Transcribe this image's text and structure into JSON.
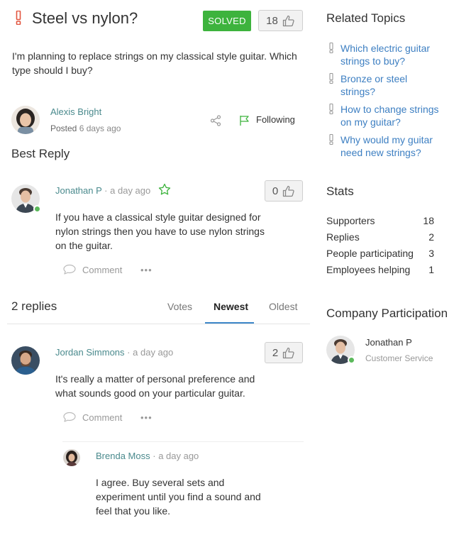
{
  "question": {
    "title": "Steel vs nylon?",
    "status_badge": "SOLVED",
    "votes": "18",
    "body": "I'm planning to replace strings on my classical style guitar. Which type should I buy?",
    "author": "Alexis Bright",
    "posted_prefix": "Posted",
    "posted_time": "6 days ago",
    "follow_label": "Following"
  },
  "best_reply": {
    "heading": "Best Reply",
    "author": "Jonathan P",
    "separator": "·",
    "time": "a day ago",
    "votes": "0",
    "body": "If you have a classical style guitar designed for nylon strings then you have to use nylon strings on the guitar.",
    "comment_label": "Comment",
    "more_label": "•••"
  },
  "replies": {
    "count_label": "2 replies",
    "tabs": [
      "Votes",
      "Newest",
      "Oldest"
    ],
    "active_tab": "Newest",
    "items": [
      {
        "author": "Jordan Simmons",
        "separator": "·",
        "time": "a day ago",
        "votes": "2",
        "body": "It's really a matter of personal preference and what sounds good on your particular guitar.",
        "comment_label": "Comment",
        "more_label": "•••",
        "sub_replies": [
          {
            "author": "Brenda Moss",
            "separator": "·",
            "time": "a day ago",
            "body": "I agree. Buy several sets and experiment until you find a sound and feel that you like."
          }
        ]
      }
    ]
  },
  "sidebar": {
    "related_heading": "Related Topics",
    "related_topics": [
      "Which electric guitar strings to buy?",
      "Bronze or steel strings?",
      "How to change strings on my guitar?",
      "Why would my guitar need new strings?"
    ],
    "stats_heading": "Stats",
    "stats": [
      {
        "label": "Supporters",
        "value": "18"
      },
      {
        "label": "Replies",
        "value": "2"
      },
      {
        "label": "People participating",
        "value": "3"
      },
      {
        "label": "Employees helping",
        "value": "1"
      }
    ],
    "company_heading": "Company Participation",
    "company_person": {
      "name": "Jonathan P",
      "role": "Customer Service"
    }
  },
  "colors": {
    "accent_link": "#3d7fc2",
    "solved_green": "#3db33d",
    "author_teal": "#4a8a8d",
    "tab_underline": "#3d87c9",
    "question_icon": "#e2553f"
  },
  "icons": {
    "question": "exclamation-icon",
    "vote": "thumbs-up-icon",
    "share": "share-icon",
    "follow": "flag-icon",
    "best": "star-icon",
    "comment": "speech-bubble-icon",
    "more": "ellipsis-icon",
    "topic": "exclamation-icon",
    "online": "online-status-icon"
  }
}
